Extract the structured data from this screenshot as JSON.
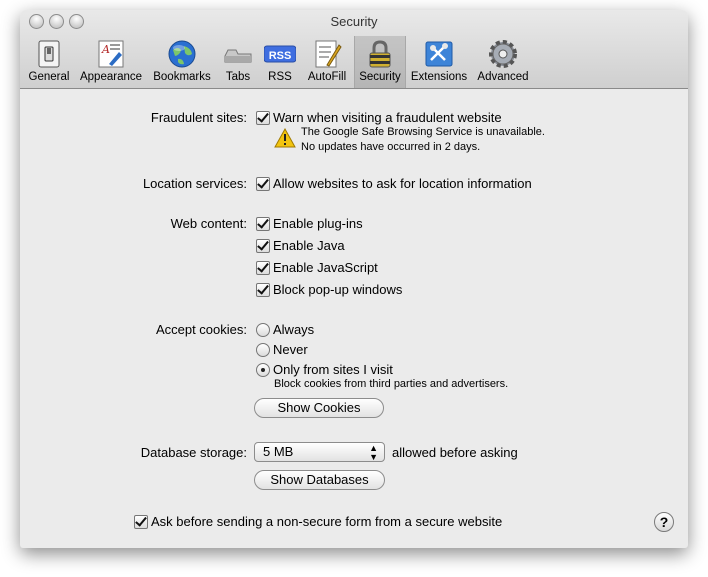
{
  "window": {
    "title": "Security"
  },
  "toolbar": {
    "items": [
      {
        "label": "General",
        "icon": "light-switch-icon"
      },
      {
        "label": "Appearance",
        "icon": "appearance-icon"
      },
      {
        "label": "Bookmarks",
        "icon": "globe-icon"
      },
      {
        "label": "Tabs",
        "icon": "tabs-icon"
      },
      {
        "label": "RSS",
        "icon": "rss-icon"
      },
      {
        "label": "AutoFill",
        "icon": "autofill-pen-icon"
      },
      {
        "label": "Security",
        "icon": "padlock-icon",
        "selected": true
      },
      {
        "label": "Extensions",
        "icon": "extensions-icon"
      },
      {
        "label": "Advanced",
        "icon": "gear-icon"
      }
    ],
    "rss_badge": "RSS"
  },
  "fraud": {
    "label": "Fraudulent sites:",
    "option": "Warn when visiting a fraudulent website",
    "checked": true,
    "warning_line1": "The Google Safe Browsing Service is unavailable.",
    "warning_line2": "No updates have occurred in 2 days."
  },
  "location": {
    "label": "Location services:",
    "option": "Allow websites to ask for location information",
    "checked": true
  },
  "web_content": {
    "label": "Web content:",
    "options": [
      {
        "label": "Enable plug-ins",
        "checked": true
      },
      {
        "label": "Enable Java",
        "checked": true
      },
      {
        "label": "Enable JavaScript",
        "checked": true
      },
      {
        "label": "Block pop-up windows",
        "checked": true
      }
    ]
  },
  "cookies": {
    "label": "Accept cookies:",
    "options": [
      "Always",
      "Never",
      "Only from sites I visit"
    ],
    "selected": "Only from sites I visit",
    "note": "Block cookies from third parties and advertisers.",
    "show_button": "Show Cookies"
  },
  "database": {
    "label": "Database storage:",
    "value": "5 MB",
    "suffix": "allowed before asking",
    "show_button": "Show Databases"
  },
  "form_warning": {
    "option": "Ask before sending a non-secure form from a secure website",
    "checked": true
  },
  "help_label": "?"
}
